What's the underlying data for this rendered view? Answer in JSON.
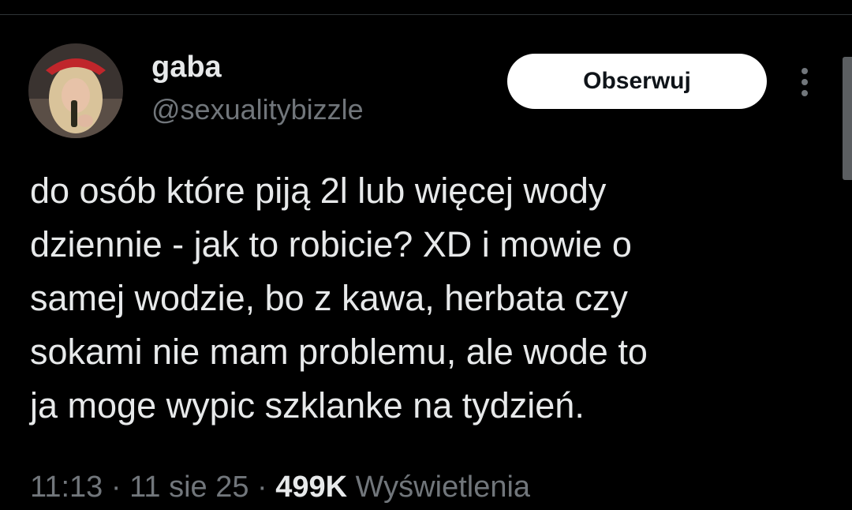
{
  "author": {
    "display_name": "gaba",
    "handle": "@sexualitybizzle"
  },
  "follow_button": {
    "label": "Obserwuj"
  },
  "tweet": {
    "lines": [
      "do osób które piją 2l lub więcej wody",
      "dziennie - jak to robicie? XD i mowie o",
      "samej wodzie, bo z kawa, herbata czy",
      "sokami nie mam problemu, ale wode to",
      "ja moge wypic szklanke na tydzień."
    ]
  },
  "meta": {
    "time": "11:13",
    "separator": " · ",
    "date": "11 sie 25",
    "views_count": "499K",
    "views_label": " Wyświetlenia"
  },
  "colors": {
    "background": "#000000",
    "text_primary": "#e7e9ea",
    "text_secondary": "#71767b",
    "button_bg": "#ffffff",
    "button_text": "#0f1419"
  },
  "icons": {
    "more": "more-vertical-icon",
    "avatar": "user-avatar"
  }
}
